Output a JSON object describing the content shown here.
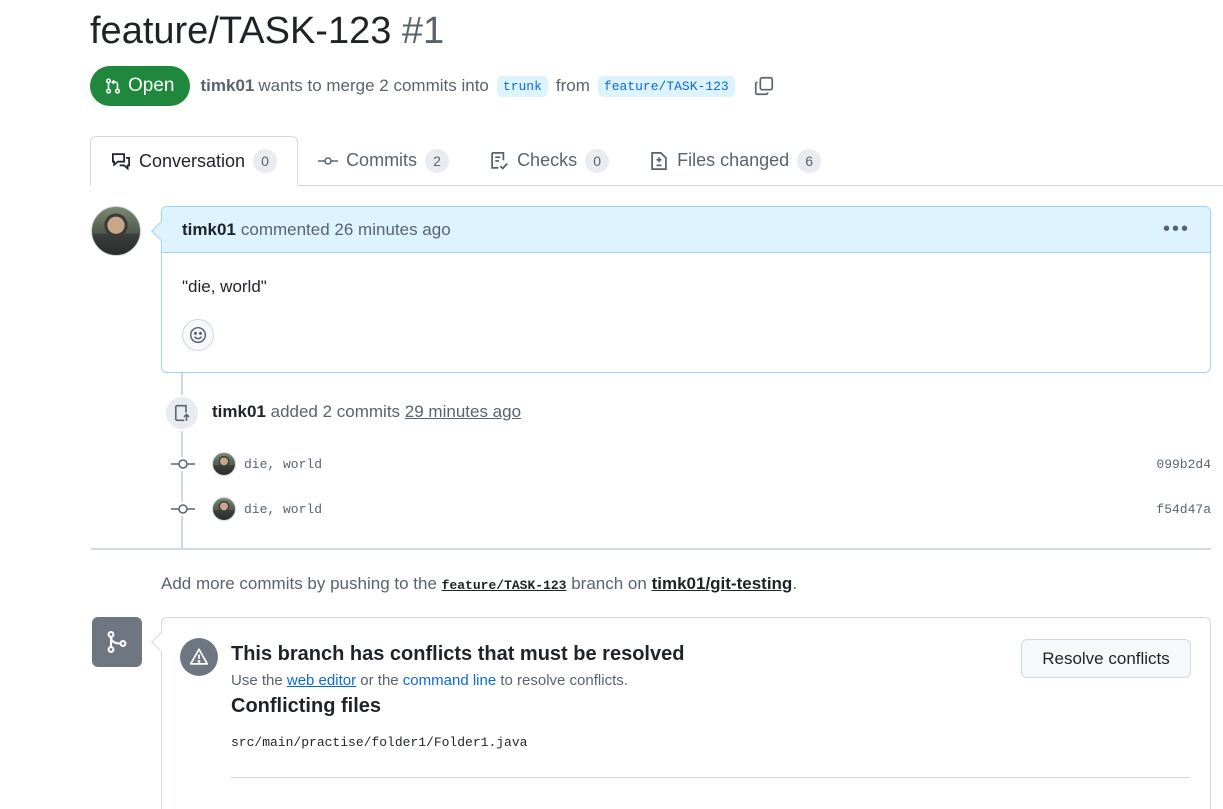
{
  "pr": {
    "title": "feature/TASK-123",
    "number": "#1",
    "state": "Open",
    "author": "timk01",
    "merge_text": "wants to merge 2 commits into",
    "base_branch": "trunk",
    "from_text": "from",
    "head_branch": "feature/TASK-123"
  },
  "tabs": [
    {
      "label": "Conversation",
      "count": "0",
      "icon": "comment-discussion-icon"
    },
    {
      "label": "Commits",
      "count": "2",
      "icon": "git-commit-icon"
    },
    {
      "label": "Checks",
      "count": "0",
      "icon": "checklist-icon"
    },
    {
      "label": "Files changed",
      "count": "6",
      "icon": "file-diff-icon"
    }
  ],
  "comment": {
    "author": "timk01",
    "action": "commented 26 minutes ago",
    "body": "\"die, world\""
  },
  "commits_event": {
    "author": "timk01",
    "action": "added 2 commits",
    "time": "29 minutes ago",
    "commits": [
      {
        "message": "die, world",
        "sha": "099b2d4"
      },
      {
        "message": "die, world",
        "sha": "f54d47a"
      }
    ]
  },
  "push_note": {
    "prefix": "Add more commits by pushing to the",
    "branch": "feature/TASK-123",
    "middle": "branch on",
    "repo": "timk01/git-testing",
    "suffix": "."
  },
  "merge_box": {
    "title": "This branch has conflicts that must be resolved",
    "sub_prefix": "Use the",
    "web_editor": "web editor",
    "sub_middle": "or the",
    "command_line": "command line",
    "sub_suffix": "to resolve conflicts.",
    "resolve_button": "Resolve conflicts",
    "files_title": "Conflicting files",
    "files": [
      "src/main/practise/folder1/Folder1.java"
    ]
  },
  "colors": {
    "open_green": "#1f883d",
    "link_blue": "#0969da",
    "comment_header_bg": "#ddf4ff"
  }
}
